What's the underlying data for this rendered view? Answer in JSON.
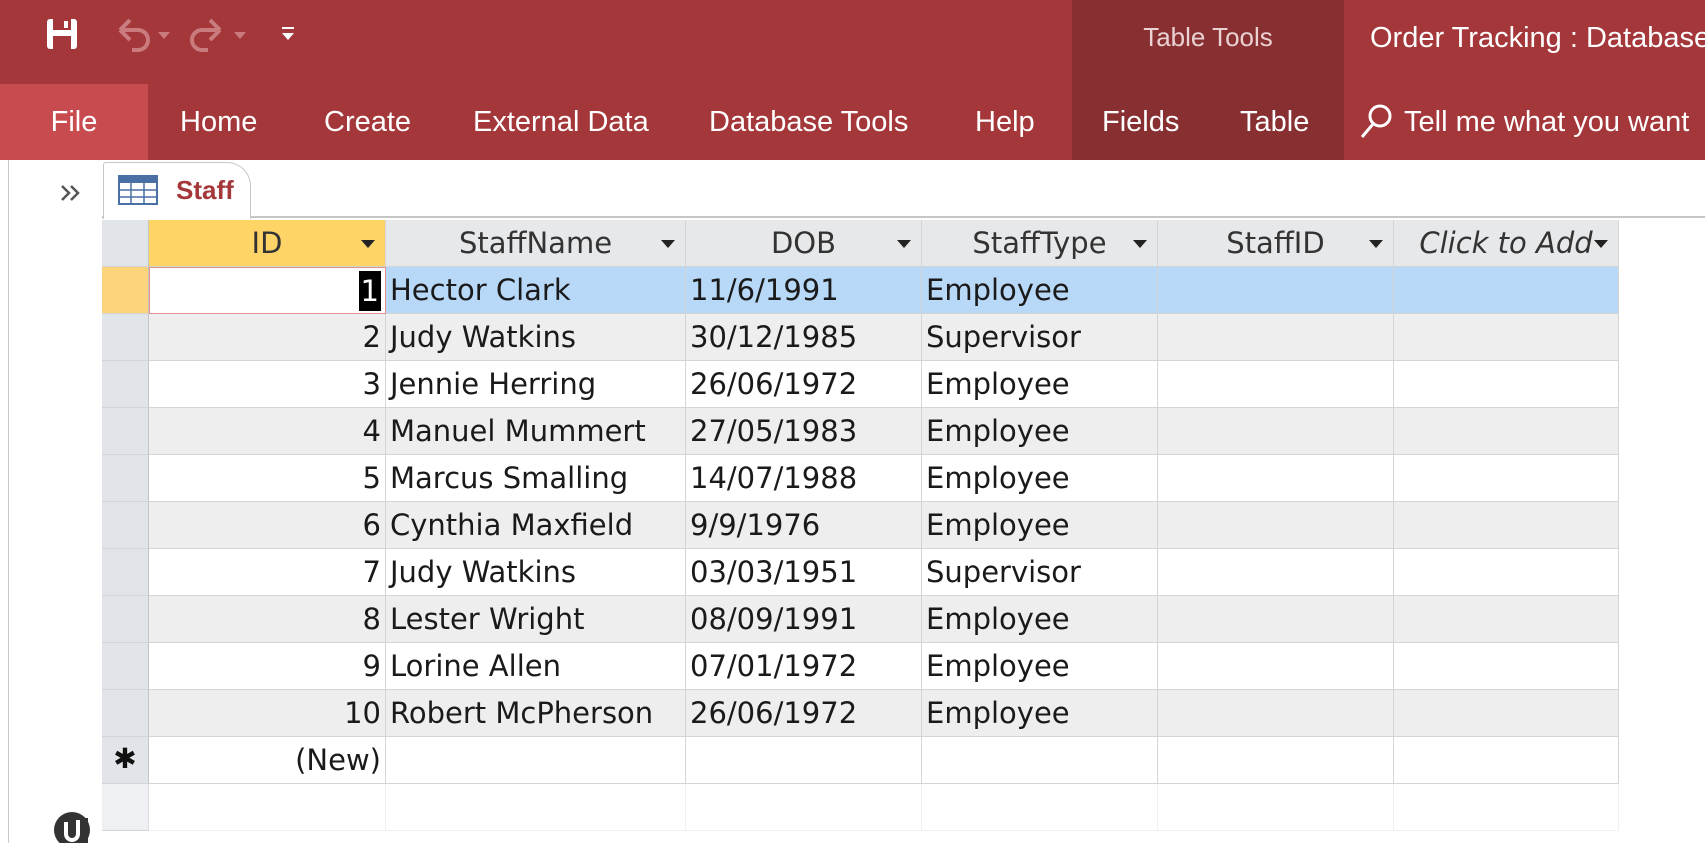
{
  "window": {
    "title": "Order Tracking : Database",
    "contextual_group": "Table Tools"
  },
  "quick_access": {
    "icons": [
      "save-icon",
      "undo-icon",
      "redo-icon",
      "customize-qat-icon"
    ]
  },
  "ribbon": {
    "tabs": [
      "File",
      "Home",
      "Create",
      "External Data",
      "Database Tools",
      "Help",
      "Fields",
      "Table"
    ],
    "tell_me": "Tell me what you want"
  },
  "document_tab": {
    "label": "Staff",
    "icon": "table-icon"
  },
  "datasheet": {
    "columns": [
      "ID",
      "StaffName",
      "DOB",
      "StaffType",
      "StaffID",
      "Click to Add"
    ],
    "rows": [
      {
        "id": "1",
        "name": "Hector Clark",
        "dob": "11/6/1991",
        "type": "Employee",
        "staffid": ""
      },
      {
        "id": "2",
        "name": "Judy Watkins",
        "dob": "30/12/1985",
        "type": "Supervisor",
        "staffid": ""
      },
      {
        "id": "3",
        "name": "Jennie Herring",
        "dob": "26/06/1972",
        "type": "Employee",
        "staffid": ""
      },
      {
        "id": "4",
        "name": "Manuel Mummert",
        "dob": "27/05/1983",
        "type": "Employee",
        "staffid": ""
      },
      {
        "id": "5",
        "name": "Marcus Smalling",
        "dob": "14/07/1988",
        "type": "Employee",
        "staffid": ""
      },
      {
        "id": "6",
        "name": "Cynthia Maxfield",
        "dob": "9/9/1976",
        "type": "Employee",
        "staffid": ""
      },
      {
        "id": "7",
        "name": "Judy Watkins",
        "dob": "03/03/1951",
        "type": "Supervisor",
        "staffid": ""
      },
      {
        "id": "8",
        "name": "Lester Wright",
        "dob": "08/09/1991",
        "type": "Employee",
        "staffid": ""
      },
      {
        "id": "9",
        "name": "Lorine Allen",
        "dob": "07/01/1972",
        "type": "Employee",
        "staffid": ""
      },
      {
        "id": "10",
        "name": "Robert McPherson",
        "dob": "26/06/1972",
        "type": "Employee",
        "staffid": ""
      }
    ],
    "new_row_label": "(New)",
    "new_row_marker": "✱"
  },
  "colors": {
    "ribbon": "#a4373a",
    "contextual": "#872f31",
    "file_tab": "#c84b4f",
    "selection": "#b8d8f8",
    "row_selector_active": "#fcd47c"
  }
}
